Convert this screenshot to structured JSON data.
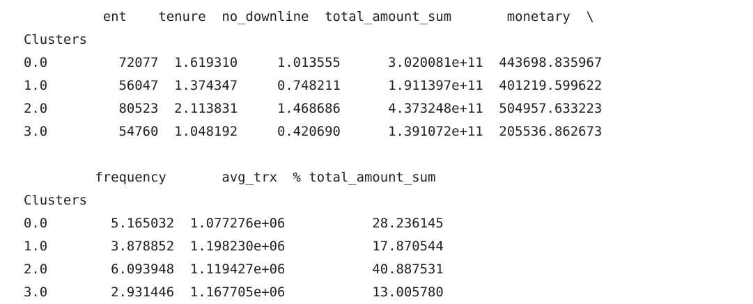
{
  "output": {
    "table1": {
      "header": "          ent    tenure  no_downline  total_amount_sum       monetary  \\",
      "index_name": "Clusters",
      "rows": [
        "0.0         72077  1.619310     1.013555      3.020081e+11  443698.835967",
        "1.0         56047  1.374347     0.748211      1.911397e+11  401219.599622",
        "2.0         80523  2.113831     1.468686      4.373248e+11  504957.633223",
        "3.0         54760  1.048192     0.420690      1.391072e+11  205536.862673"
      ]
    },
    "table2": {
      "header": "         frequency       avg_trx  % total_amount_sum",
      "index_name": "Clusters",
      "rows": [
        "0.0        5.165032  1.077276e+06           28.236145",
        "1.0        3.878852  1.198230e+06           17.870544",
        "2.0        6.093948  1.119427e+06           40.887531",
        "3.0        2.931446  1.167705e+06           13.005780"
      ]
    }
  }
}
